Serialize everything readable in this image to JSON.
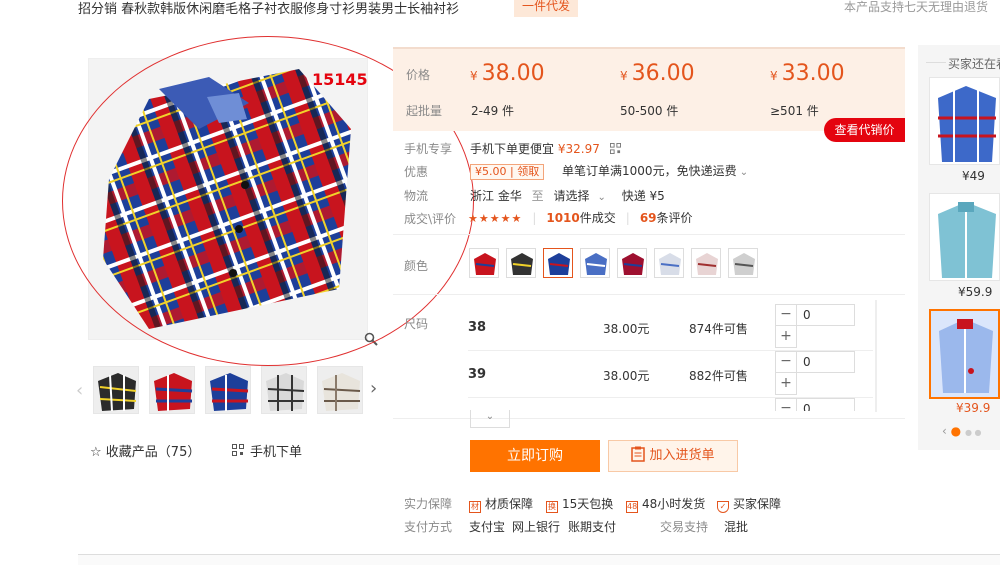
{
  "header": {
    "title": "招分销 春秋款韩版休闲磨毛格子衬衣服修身寸衫男装男士长袖衬衫",
    "tag": "一件代发",
    "right_note": "本产品支持七天无理由退货"
  },
  "gallery": {
    "main_label": "15145",
    "favorite": "收藏产品（75）",
    "mobile_order": "手机下单"
  },
  "pricing": {
    "price_label": "价格",
    "moq_label": "起批量",
    "tiers": [
      {
        "yen": "¥",
        "price": "38.00",
        "range": "2-49 件"
      },
      {
        "yen": "¥",
        "price": "36.00",
        "range": "50-500 件"
      },
      {
        "yen": "¥",
        "price": "33.00",
        "range": "≥501 件"
      }
    ],
    "quote_button": "查看代销价"
  },
  "details": {
    "mobile_label": "手机专享",
    "mobile_text": "手机下单更便宜",
    "mobile_price": "¥32.97",
    "promo_label": "优惠",
    "coupon_amount": "¥5.00",
    "coupon_action": "领取",
    "promo_text": "单笔订单满1000元，免快递运费",
    "logistics_label": "物流",
    "origin": "浙江 金华",
    "to": "至",
    "destination": "请选择",
    "shipping": "快递 ¥5",
    "deals_label": "成交\\评价",
    "stars": "★★★★★",
    "sold_count": "1010",
    "sold_suffix": "件成交",
    "review_count": "69",
    "review_suffix": "条评价"
  },
  "colors": {
    "label": "颜色",
    "count": 8
  },
  "sizes": {
    "label": "尺码",
    "rows": [
      {
        "name": "38",
        "price": "38.00元",
        "stock": "874件可售",
        "qty": "0"
      },
      {
        "name": "39",
        "price": "38.00元",
        "stock": "882件可售",
        "qty": "0"
      },
      {
        "name": "",
        "price": "",
        "stock": "",
        "qty": "0"
      }
    ]
  },
  "actions": {
    "buy": "立即订购",
    "cart": "加入进货单"
  },
  "guarantee": {
    "label": "实力保障",
    "items": [
      "材质保障",
      "15天包换",
      "48小时发货",
      "买家保障"
    ],
    "pay_label": "支付方式",
    "pay_methods": [
      "支付宝",
      "网上银行",
      "账期支付"
    ],
    "trade_label": "交易支持",
    "trade_value": "混批"
  },
  "recommend": {
    "title": "买家还在看",
    "items": [
      {
        "price": "¥49"
      },
      {
        "price": "¥59.9"
      },
      {
        "price": "¥39.9"
      }
    ]
  },
  "colors_palette": {
    "accent": "#e4551d",
    "buy": "#ff7300",
    "quote": "#e4040f",
    "price_bg": "#fdf0e6"
  }
}
